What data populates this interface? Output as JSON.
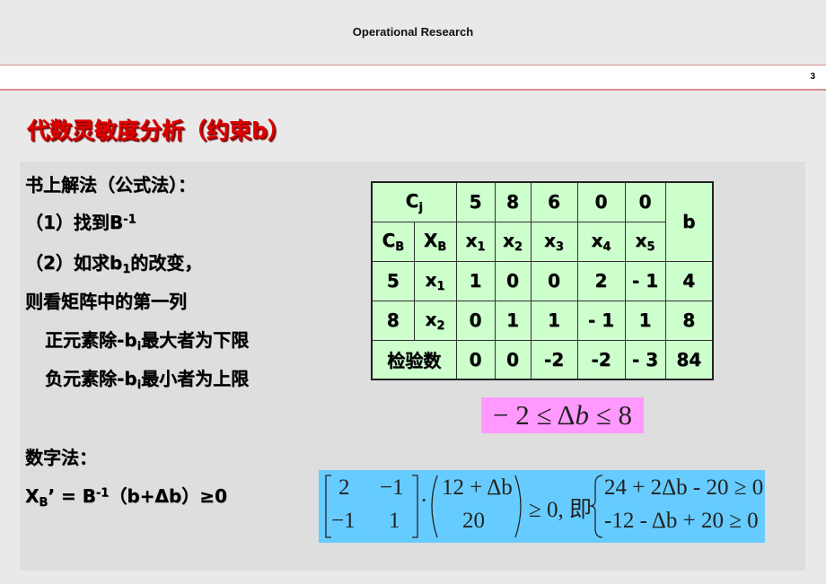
{
  "header": {
    "title": "Operational Research",
    "page_number": "3"
  },
  "slide_title": "代数灵敏度分析（约束b）",
  "left_text": {
    "line1": "书上解法（公式法）：",
    "line2_prefix": "（1）找到B",
    "line2_sup": "-1",
    "line3_prefix": "（2）如求b",
    "line3_sub": "1",
    "line3_suffix": "的改变，",
    "line4": "则看矩阵中的第一列",
    "line5_prefix": "正元素除-b",
    "line5_sub": "i",
    "line5_suffix": "最大者为下限",
    "line6_prefix": "负元素除-b",
    "line6_sub": "i",
    "line6_suffix": "最小者为上限",
    "line7": "数字法：",
    "line8_x": "X",
    "line8_sub": "B",
    "line8_mid": "’ = B",
    "line8_sup": "-1",
    "line8_suffix": "（b+Δb）≥0"
  },
  "simplex_table": {
    "cj_label": "C",
    "cj_sub": "j",
    "cj_values": [
      "5",
      "8",
      "6",
      "0",
      "0"
    ],
    "b_label": "b",
    "cb_label": "C",
    "cb_sub": "B",
    "xb_label": "X",
    "xb_sub": "B",
    "var_names": [
      {
        "base": "x",
        "sub": "1"
      },
      {
        "base": "x",
        "sub": "2"
      },
      {
        "base": "x",
        "sub": "3"
      },
      {
        "base": "x",
        "sub": "4"
      },
      {
        "base": "x",
        "sub": "5"
      }
    ],
    "rows": [
      {
        "cb": "5",
        "xb": "x",
        "xb_sub": "1",
        "values": [
          "1",
          "0",
          "0",
          "2",
          "- 1"
        ],
        "b": "4"
      },
      {
        "cb": "8",
        "xb": "x",
        "xb_sub": "2",
        "values": [
          "0",
          "1",
          "1",
          "- 1",
          "1"
        ],
        "b": "8"
      }
    ],
    "check_row": {
      "label": "检验数",
      "values": [
        "0",
        "0",
        "-2",
        "-2",
        "- 3"
      ],
      "b": "84"
    }
  },
  "range_formula": {
    "left": "− 2 ≤ Δ",
    "var": "b",
    "right": " ≤ 8"
  },
  "matrix_formula": {
    "matrix": [
      [
        "2",
        "−1"
      ],
      [
        "−1",
        "1"
      ]
    ],
    "dot": "·",
    "vector": [
      "12 + Δb",
      "20"
    ],
    "relation": "≥ 0, 即",
    "conditions": [
      "24 + 2Δb - 20 ≥ 0",
      "-12 - Δb + 20 ≥ 0"
    ]
  },
  "colors": {
    "title_red": "#e00000",
    "table_green": "#ccffcc",
    "range_pink": "#ff99ff",
    "matrix_blue": "#66ccff"
  }
}
